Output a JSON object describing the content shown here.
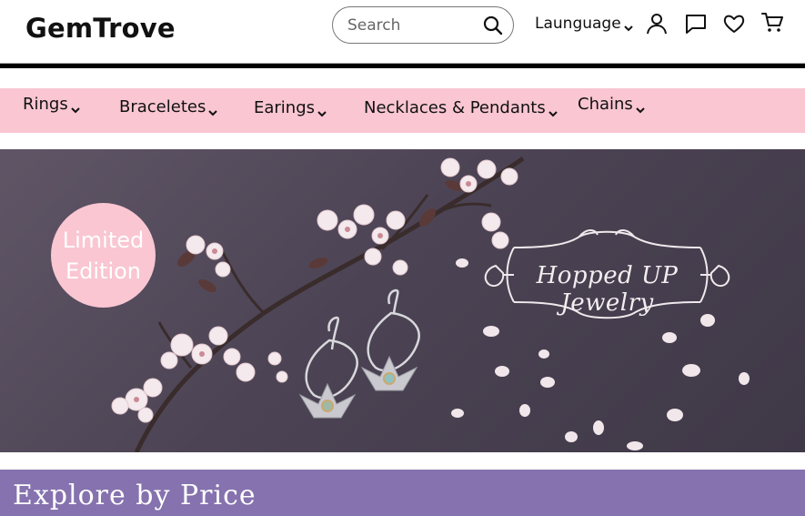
{
  "header": {
    "logo": "GemTrove",
    "search_placeholder": "Search",
    "language_label": "Launguage"
  },
  "nav": {
    "items": [
      {
        "label": "Rings"
      },
      {
        "label": "Braceletes"
      },
      {
        "label": "Earings"
      },
      {
        "label": "Necklaces & Pendants"
      },
      {
        "label": "Chains"
      }
    ]
  },
  "hero": {
    "badge_line1": "Limited",
    "badge_line2": "Edition",
    "brand_text": "Hopped UP Jewelry"
  },
  "section": {
    "title": "Explore by Price"
  },
  "colors": {
    "nav_background": "#f9c6d2",
    "badge_background": "#f9c6d2",
    "section_background": "#8572ae",
    "hero_background": "#4c4454"
  },
  "icons": [
    "search-icon",
    "chevron-down-icon",
    "user-icon",
    "chat-icon",
    "heart-icon",
    "cart-icon"
  ]
}
